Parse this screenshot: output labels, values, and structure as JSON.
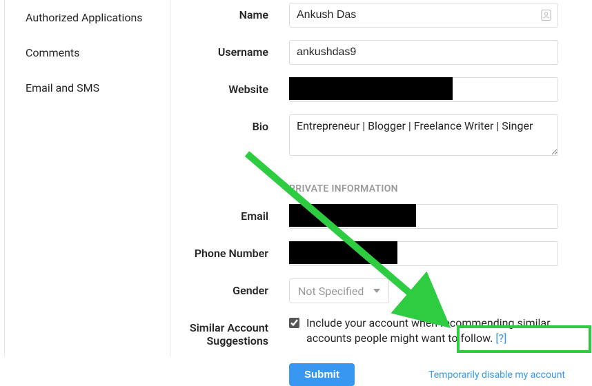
{
  "sidebar": {
    "items": [
      {
        "label": "Authorized Applications"
      },
      {
        "label": "Comments"
      },
      {
        "label": "Email and SMS"
      }
    ]
  },
  "form": {
    "name_label": "Name",
    "name_value": "Ankush Das",
    "username_label": "Username",
    "username_value": "ankushdas9",
    "website_label": "Website",
    "website_value": "",
    "bio_label": "Bio",
    "bio_value": "Entrepreneur | Blogger | Freelance Writer | Singer",
    "private_header": "PRIVATE INFORMATION",
    "email_label": "Email",
    "email_value": "",
    "phone_label": "Phone Number",
    "phone_value": "",
    "gender_label": "Gender",
    "gender_value": "Not Specified",
    "similar_label": "Similar Account Suggestions",
    "similar_text": "Include your account when recommending similar accounts people might want to follow. ",
    "help_link": "[?]",
    "submit_label": "Submit",
    "disable_link": "Temporarily disable my account"
  }
}
